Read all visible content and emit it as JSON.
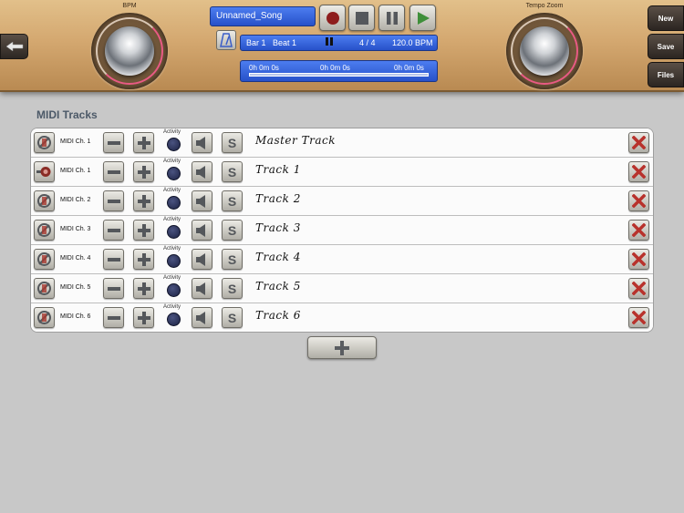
{
  "header": {
    "bpm_label": "BPM",
    "tempo_zoom_label": "Tempo Zoom",
    "song_name": "Unnamed_Song",
    "bar": "Bar 1",
    "beat": "Beat 1",
    "time_signature": "4 / 4",
    "tempo": "120.0 BPM",
    "time_left": "0h 0m 0s",
    "time_mid": "0h 0m 0s",
    "time_right": "0h 0m 0s",
    "new_label": "New",
    "save_label": "Save",
    "files_label": "Files"
  },
  "main": {
    "section_title": "MIDI Tracks",
    "activity_label": "Activity",
    "tracks": [
      {
        "channel": "MIDI Ch. 1",
        "name": "Master Track"
      },
      {
        "channel": "MIDI Ch. 1",
        "name": "Track 1"
      },
      {
        "channel": "MIDI Ch. 2",
        "name": "Track 2"
      },
      {
        "channel": "MIDI Ch. 3",
        "name": "Track 3"
      },
      {
        "channel": "MIDI Ch. 4",
        "name": "Track 4"
      },
      {
        "channel": "MIDI Ch. 5",
        "name": "Track 5"
      },
      {
        "channel": "MIDI Ch. 6",
        "name": "Track 6"
      }
    ],
    "solo_label": "S"
  },
  "colors": {
    "accent_blue": "#3563dd",
    "delete_red": "#b8322c",
    "record_red": "#8e1d1d",
    "play_green": "#3f8f3a"
  }
}
